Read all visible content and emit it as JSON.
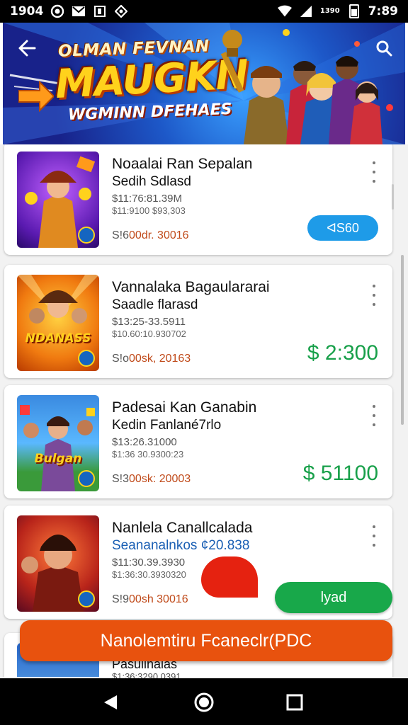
{
  "status_bar": {
    "time_left": "1904",
    "network_label": "1390",
    "time_right": "7:89",
    "icons": [
      "record-icon",
      "mail-icon",
      "notification-icon",
      "data-saver-icon",
      "wifi-icon",
      "signal-icon",
      "battery-icon"
    ]
  },
  "banner": {
    "line1": "OLMAN FEVNAN",
    "line2": "MAUGKN",
    "line3": "WGMINN DFEHAES",
    "back_icon": "back-arrow-icon",
    "search_icon": "search-icon"
  },
  "items": [
    {
      "title": "Noaalai Ran Sepalan",
      "subtitle": "Sedih Sdlasd",
      "meta1": "$11:76:81.39M",
      "meta2": "$11:9100 $93,303",
      "date_lead": "S!6",
      "date_rest": "00dr. 30016",
      "price": "ᐊS60",
      "price_style": "pill",
      "thumb_text": ""
    },
    {
      "title": "Vannalaka Bagaulararai",
      "subtitle": "Saadle flarasd",
      "meta1": "$13:25-33.5911",
      "meta2": "$10.60:10.930702",
      "date_lead": "S!o",
      "date_rest": "00sk, 20163",
      "price": "$ 2:300",
      "price_style": "text",
      "thumb_text": "NDANASS"
    },
    {
      "title": "Padesai Kan Ganabin",
      "subtitle": "Kedin Fanlané7rlo",
      "meta1": "$13:26.31000",
      "meta2": "$1:36 30.9300:23",
      "date_lead": "S!3",
      "date_rest": "00sk: 20003",
      "price": "$ 51100",
      "price_style": "text",
      "thumb_text": "Bulgan"
    },
    {
      "title": "Nanlela Canallcalada",
      "subtitle": "Seananalnkos ¢20.838",
      "meta1": "$11:30.39.3930",
      "meta2": "$1:36:30.3930320",
      "date_lead": "S!9",
      "date_rest": "00sh 30016",
      "price": "",
      "price_style": "none",
      "thumb_text": ""
    }
  ],
  "peek_item": {
    "title": "Pasullnalas",
    "meta": "$1:36:3290.0391"
  },
  "green_button_label": "lyad",
  "orange_button_label": "Nanolemtiru Fcaneclr(PDC",
  "nav": [
    "back-triangle-icon",
    "home-circle-icon",
    "recents-square-icon"
  ]
}
